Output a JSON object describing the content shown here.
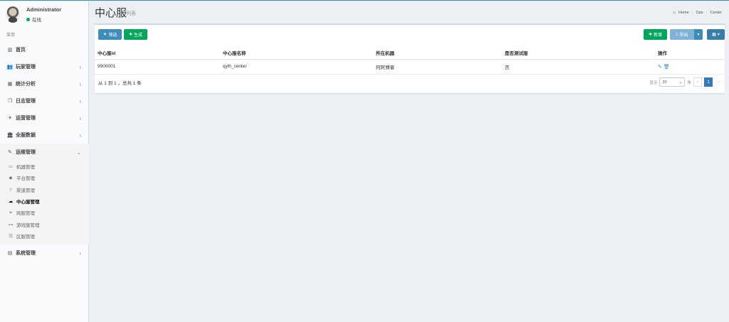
{
  "user": {
    "name": "Administrator",
    "status": "在线"
  },
  "sidebar": {
    "header": "菜单",
    "items": [
      {
        "label": "首页",
        "icon": "bar-chart-icon"
      },
      {
        "label": "玩家管理",
        "icon": "users-icon"
      },
      {
        "label": "统计分析",
        "icon": "calculator-icon"
      },
      {
        "label": "日志管理",
        "icon": "copy-icon"
      },
      {
        "label": "运营管理",
        "icon": "plane-icon"
      },
      {
        "label": "全服数据",
        "icon": "bank-icon"
      },
      {
        "label": "运维管理",
        "icon": "tools-icon"
      },
      {
        "label": "系统管理",
        "icon": "list-icon"
      }
    ],
    "sub_items": [
      {
        "label": "机器管理",
        "icon": "monitor-icon"
      },
      {
        "label": "平台管理",
        "icon": "diamond-icon"
      },
      {
        "label": "渠道管理",
        "icon": "funnel-icon"
      },
      {
        "label": "中心服管理",
        "icon": "cloud-icon"
      },
      {
        "label": "跨服管理",
        "icon": "link-icon"
      },
      {
        "label": "游戏服管理",
        "icon": "gamepad-icon"
      },
      {
        "label": "区服管理",
        "icon": "list-ul-icon"
      }
    ]
  },
  "header": {
    "title": "中心服",
    "subtitle": "列表",
    "breadcrumb": [
      "Home",
      "Ops",
      "Center"
    ]
  },
  "toolbar": {
    "filter_label": "筛选",
    "generate_label": "生成",
    "add_label": "新增",
    "export_label": "导出"
  },
  "table": {
    "columns": [
      "中心服id",
      "中心服名称",
      "所在机器",
      "是否测试服",
      "操作"
    ],
    "rows": [
      {
        "id": "9900001",
        "name": "qylh_center",
        "machine": "阿阿博睿",
        "test": "否"
      }
    ]
  },
  "footer": {
    "summary": "从 1 到 1 ，总共 1 条",
    "show_label": "显示",
    "page_size": "20",
    "per_label": "条",
    "prev": "‹",
    "current_page": "1",
    "next": "›"
  },
  "colors": {
    "accent": "#3c8dbc",
    "green": "#00a65a",
    "sidebar_bg": "#f9fafc"
  }
}
